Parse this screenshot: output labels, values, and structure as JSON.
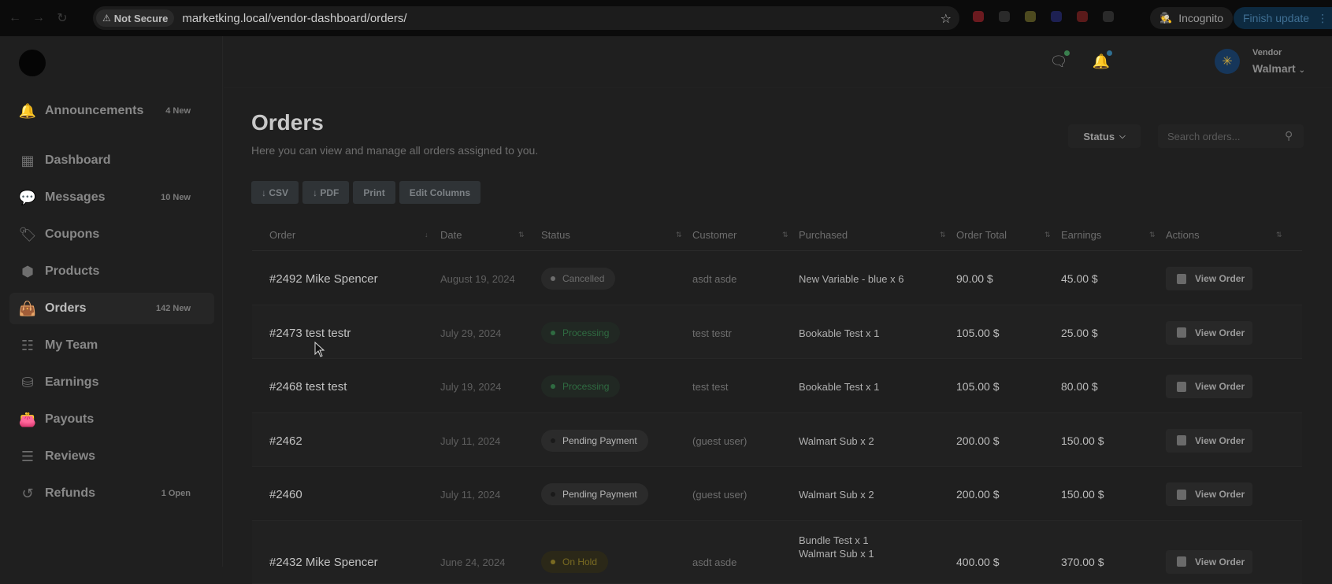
{
  "browser": {
    "security_label": "Not Secure",
    "url": "marketking.local/vendor-dashboard/orders/",
    "incognito_label": "Incognito",
    "update_label": "Finish update",
    "extension_colors": [
      "#6b1a1f",
      "#2a2a2a",
      "#4d4a1f",
      "#1d2052",
      "#5a1a1a",
      "#2a2a2a"
    ]
  },
  "sidebar": {
    "items": [
      {
        "label": "Announcements",
        "badge": "4 New",
        "icon": "bell-icon"
      },
      {
        "label": "Dashboard",
        "badge": "",
        "icon": "dashboard-icon"
      },
      {
        "label": "Messages",
        "badge": "10 New",
        "icon": "message-icon"
      },
      {
        "label": "Coupons",
        "badge": "",
        "icon": "coupon-icon"
      },
      {
        "label": "Products",
        "badge": "",
        "icon": "box-icon"
      },
      {
        "label": "Orders",
        "badge": "142 New",
        "icon": "shopping-bag-icon",
        "active": true
      },
      {
        "label": "My Team",
        "badge": "",
        "icon": "team-icon"
      },
      {
        "label": "Earnings",
        "badge": "",
        "icon": "coins-icon"
      },
      {
        "label": "Payouts",
        "badge": "",
        "icon": "wallet-icon"
      },
      {
        "label": "Reviews",
        "badge": "",
        "icon": "review-icon"
      },
      {
        "label": "Refunds",
        "badge": "1 Open",
        "icon": "refund-icon"
      }
    ]
  },
  "topbar": {
    "vendor_role": "Vendor",
    "vendor_name": "Walmart"
  },
  "main": {
    "title": "Orders",
    "subtitle": "Here you can view and manage all orders assigned to you.",
    "status_filter": "Status",
    "search_placeholder": "Search orders...",
    "export_buttons": [
      "↓ CSV",
      "↓ PDF",
      "Print",
      "Edit Columns"
    ]
  },
  "table": {
    "columns": [
      "Order",
      "Date",
      "Status",
      "Customer",
      "Purchased",
      "Order Total",
      "Earnings",
      "Actions"
    ],
    "action_label": "View Order",
    "rows": [
      {
        "order": "#2492 Mike Spencer",
        "date": "August 19, 2024",
        "status": "Cancelled",
        "status_kind": "cancelled",
        "customer": "asdt asde",
        "purchased": [
          "New Variable - blue x 6"
        ],
        "total": "90.00 $",
        "earnings": "45.00 $"
      },
      {
        "order": "#2473 test testr",
        "date": "July 29, 2024",
        "status": "Processing",
        "status_kind": "processing",
        "customer": "test testr",
        "purchased": [
          "Bookable Test x 1"
        ],
        "total": "105.00 $",
        "earnings": "25.00 $"
      },
      {
        "order": "#2468 test test",
        "date": "July 19, 2024",
        "status": "Processing",
        "status_kind": "processing",
        "customer": "test test",
        "purchased": [
          "Bookable Test x 1"
        ],
        "total": "105.00 $",
        "earnings": "80.00 $"
      },
      {
        "order": "#2462",
        "date": "July 11, 2024",
        "status": "Pending Payment",
        "status_kind": "pending",
        "customer": "(guest user)",
        "purchased": [
          "Walmart Sub x 2"
        ],
        "total": "200.00 $",
        "earnings": "150.00 $"
      },
      {
        "order": "#2460",
        "date": "July 11, 2024",
        "status": "Pending Payment",
        "status_kind": "pending",
        "customer": "(guest user)",
        "purchased": [
          "Walmart Sub x 2"
        ],
        "total": "200.00 $",
        "earnings": "150.00 $"
      },
      {
        "order": "#2432 Mike Spencer",
        "date": "June 24, 2024",
        "status": "On Hold",
        "status_kind": "onhold",
        "customer": "asdt asde",
        "purchased": [
          "Bundle Test x 1",
          "Walmart Sub x 1"
        ],
        "total": "400.00 $",
        "earnings": "370.00 $"
      }
    ]
  }
}
